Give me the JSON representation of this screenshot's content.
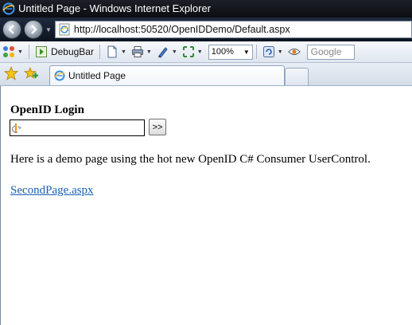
{
  "window": {
    "title": "Untitled Page - Windows Internet Explorer"
  },
  "address_bar": {
    "url": "http://localhost:50520/OpenIDDemo/Default.aspx"
  },
  "toolbar": {
    "debugbar_label": "DebugBar",
    "zoom_value": "100%",
    "search_placeholder": "Google"
  },
  "tabs": [
    {
      "label": "Untitled Page"
    }
  ],
  "page": {
    "login_title": "OpenID Login",
    "openid_value": "",
    "go_button_label": ">>",
    "demo_text": "Here is a demo page using the hot new OpenID C# Consumer UserControl.",
    "second_page_link": "SecondPage.aspx"
  },
  "colors": {
    "link": "#1a5fb4",
    "title_bar": "#0b0d12",
    "openid_orange": "#f7931e"
  },
  "icons": {
    "window": "ie-logo-icon",
    "back": "back-arrow-icon",
    "forward": "forward-arrow-icon",
    "page": "ie-page-icon",
    "favorites": "star-icon",
    "add_favorites": "add-favorite-icon"
  }
}
